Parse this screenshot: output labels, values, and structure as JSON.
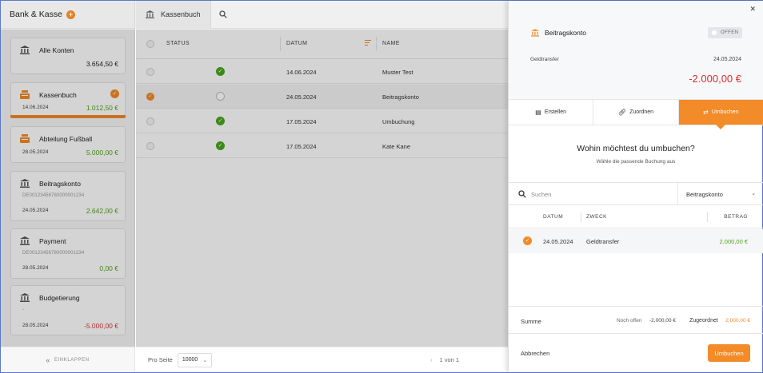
{
  "sidebar": {
    "title": "Bank & Kasse",
    "collapse_label": "EINKLAPPEN",
    "accounts": [
      {
        "name": "Alle Konten",
        "iban": "",
        "date": "",
        "amount": "3.654,50 €",
        "tone": "neutral",
        "icon": "bank-icon"
      },
      {
        "name": "Kassenbuch",
        "iban": "",
        "date": "14.06.2024",
        "amount": "1.012,50 €",
        "tone": "pos",
        "icon": "cash-register-icon"
      },
      {
        "name": "Abteilung Fußball",
        "iban": "",
        "date": "28.05.2024",
        "amount": "5.000,00 €",
        "tone": "pos",
        "icon": "cash-register-icon"
      },
      {
        "name": "Beitragskonto",
        "iban": "DE00123456780000001234",
        "date": "24.05.2024",
        "amount": "2.642,00 €",
        "tone": "pos",
        "icon": "bank-icon"
      },
      {
        "name": "Payment",
        "iban": "DE00123456780000001234",
        "date": "28.05.2024",
        "amount": "0,00 €",
        "tone": "pos",
        "icon": "bank-icon"
      },
      {
        "name": "Budgetierung",
        "iban": "-",
        "date": "28.05.2024",
        "amount": "-5.000,00 €",
        "tone": "neg",
        "icon": "bank-icon"
      }
    ]
  },
  "main": {
    "tab_label": "Kassenbuch",
    "columns": {
      "status": "STATUS",
      "date": "DATUM",
      "name": "NAME"
    },
    "rows": [
      {
        "status": "ok",
        "selected": false,
        "date": "14.06.2024",
        "name": "Muster Test"
      },
      {
        "status": "empty",
        "selected": true,
        "date": "24.05.2024",
        "name": "Beitragskonto"
      },
      {
        "status": "ok",
        "selected": false,
        "date": "17.05.2024",
        "name": "Umbuchung"
      },
      {
        "status": "ok",
        "selected": false,
        "date": "17.05.2024",
        "name": "Kate Kane"
      }
    ],
    "footer": {
      "per_page_label": "Pro Seite",
      "per_page_value": "10000",
      "pager_text": "1 von 1"
    }
  },
  "panel": {
    "title": "Beitragskonto",
    "badge": "OFFEN",
    "subtitle": "Geldtransfer",
    "date": "24.05.2024",
    "amount": "-2.000,00 €",
    "tabs": [
      {
        "label": "Erstellen",
        "icon": "document-plus-icon"
      },
      {
        "label": "Zuordnen",
        "icon": "link-icon"
      },
      {
        "label": "Umbuchen",
        "icon": "transfer-arrows-icon"
      }
    ],
    "question": "Wohin möchtest du umbuchen?",
    "question_sub": "Wähle die passende Buchung aus",
    "search_placeholder": "Suchen",
    "account_select": "Beitragskonto",
    "columns": {
      "date": "DATUM",
      "purpose": "ZWECK",
      "amount": "BETRAG"
    },
    "booking": {
      "date": "24.05.2024",
      "purpose": "Geldtransfer",
      "amount": "2.000,00 €"
    },
    "summary": {
      "label": "Summe",
      "open_label": "Noch offen",
      "open_value": "-2.000,00 €",
      "assigned_label": "Zugeordnet",
      "assigned_value": "2.000,00 €"
    },
    "cancel_label": "Abbrechen",
    "submit_label": "Umbuchen"
  },
  "colors": {
    "accent": "#f28b28",
    "positive": "#53a318",
    "negative": "#d9363e"
  }
}
